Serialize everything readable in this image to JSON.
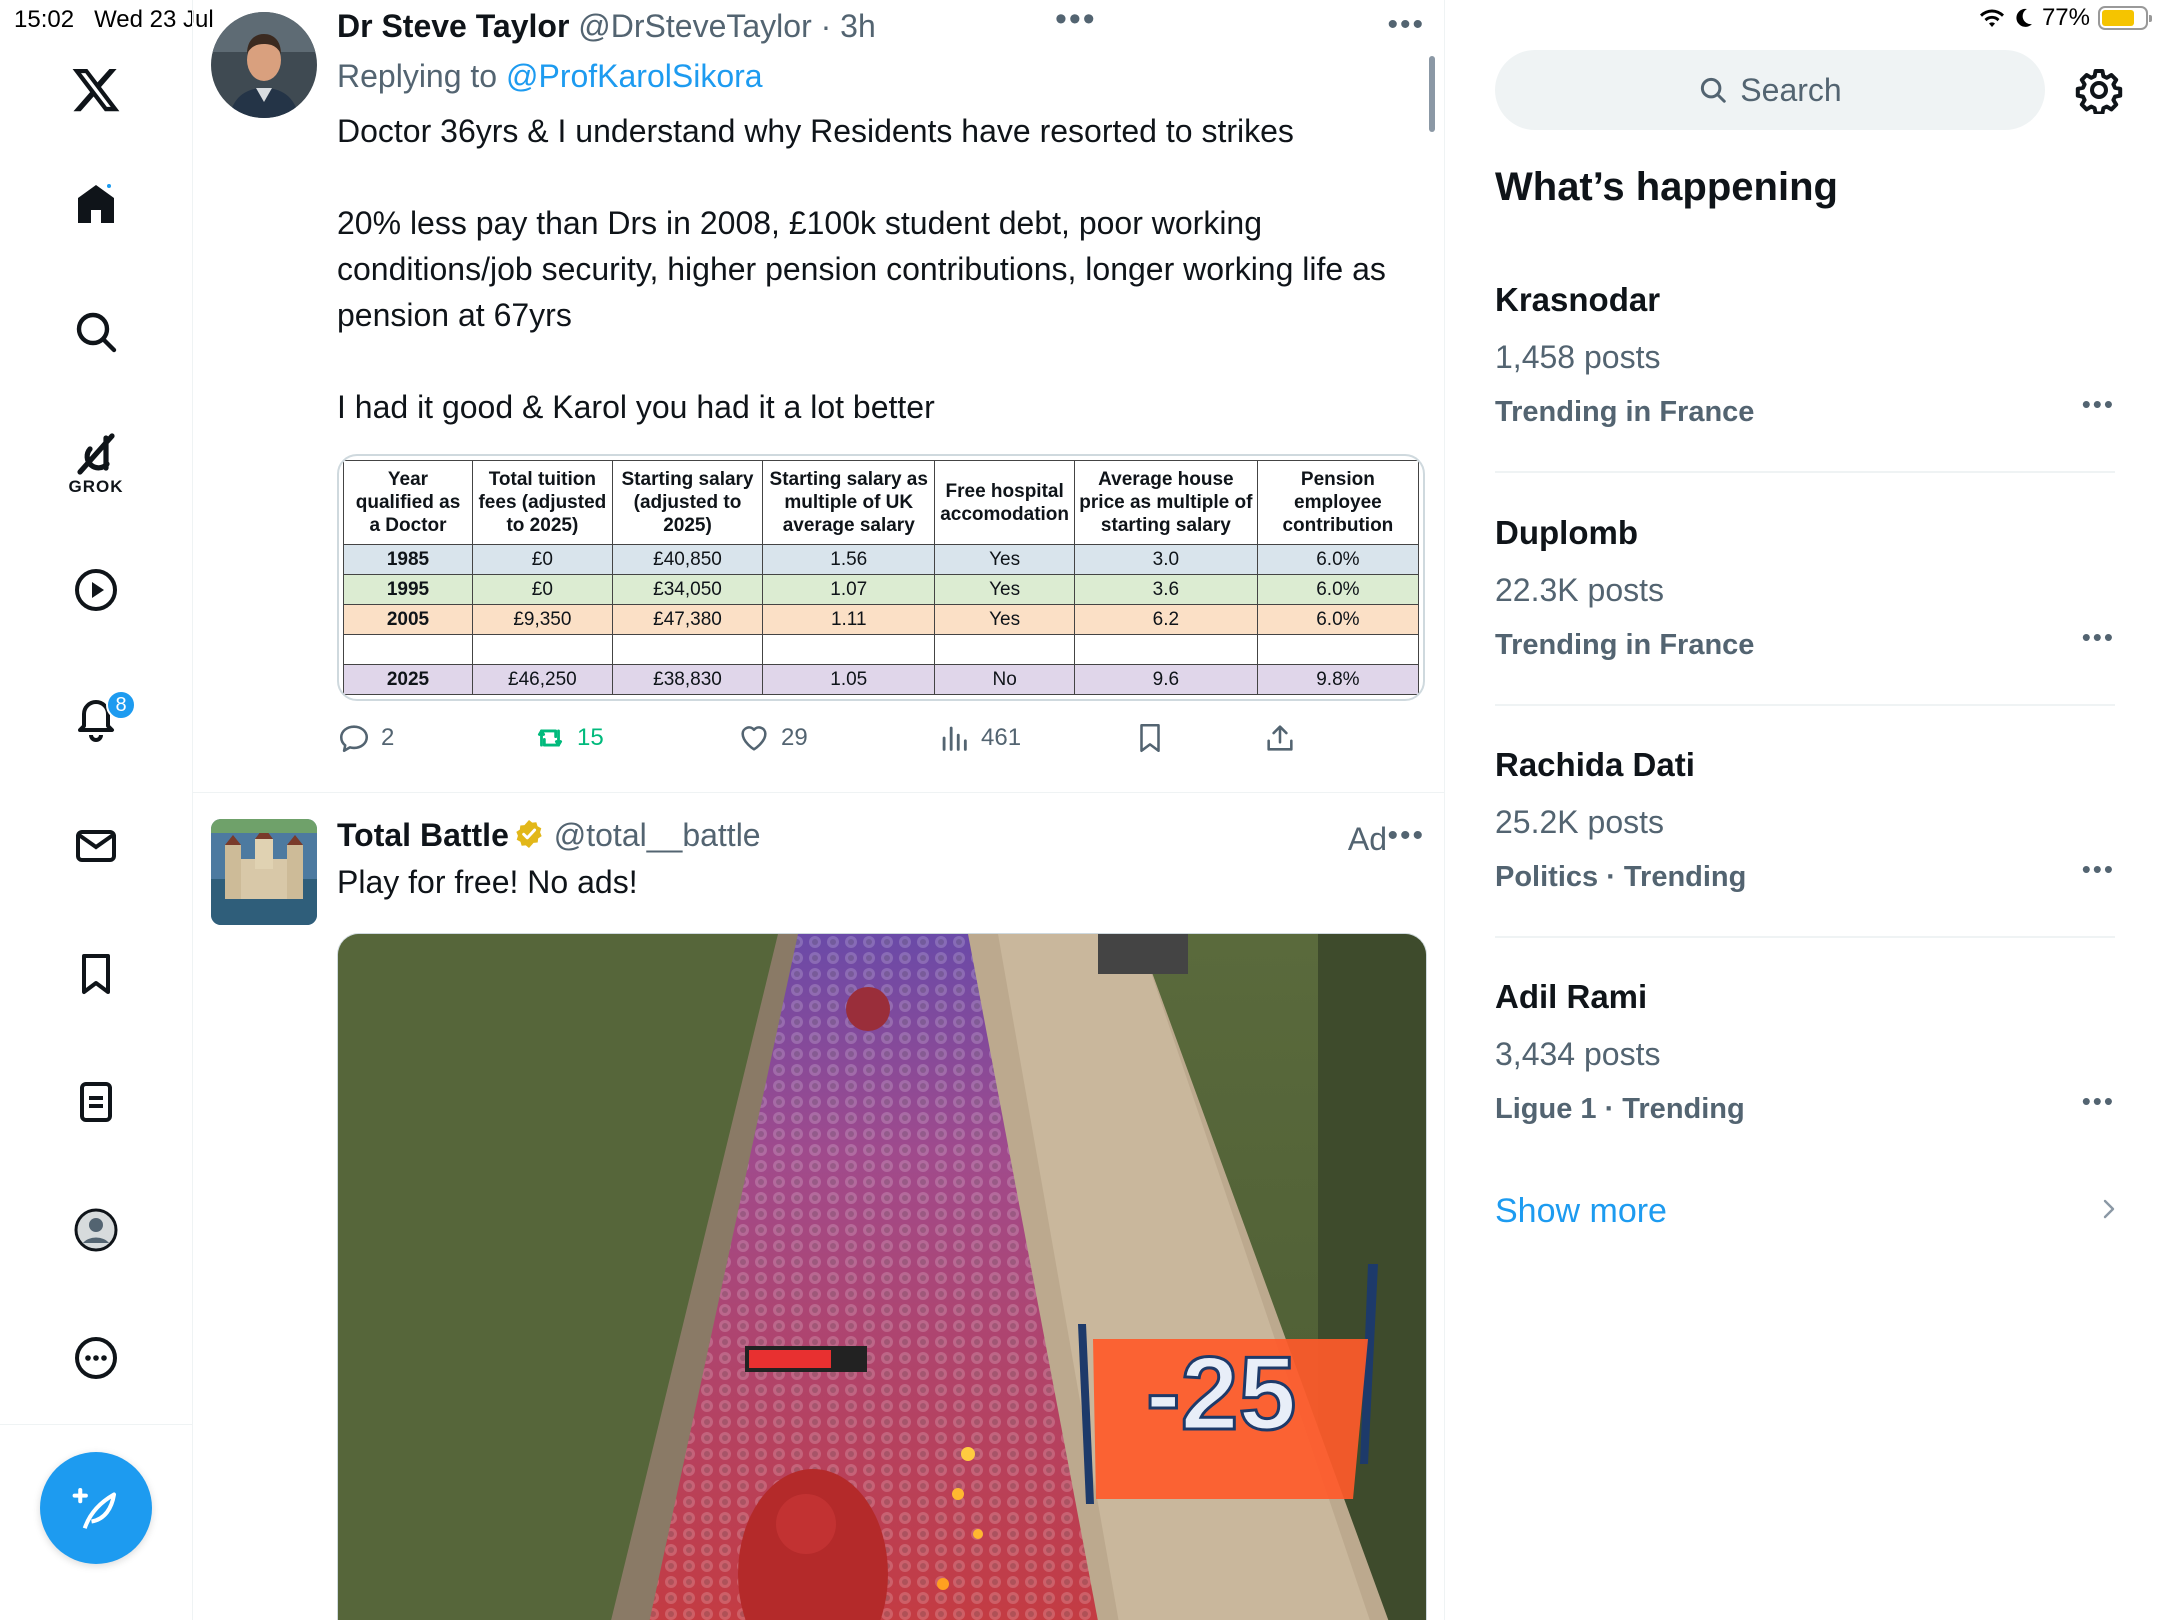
{
  "status": {
    "time": "15:02",
    "date": "Wed 23 Jul",
    "battery": "77%",
    "battery_level": 0.77
  },
  "nav": {
    "grok_label": "GROK",
    "notifications_badge": "8"
  },
  "tweet1": {
    "name": "Dr Steve Taylor",
    "handle": "@DrSteveTaylor",
    "time": "· 3h",
    "replying_to_prefix": "Replying to ",
    "replying_to_handle": "@ProfKarolSikora",
    "text_p1": "Doctor 36yrs & I understand why Residents have resorted to strikes",
    "text_p2": "20% less pay than Drs in 2008, £100k student debt, poor working conditions/job security, higher pension contributions, longer working life as pension at 67yrs",
    "text_p3": "I had it good & Karol you had it a lot better",
    "table": {
      "headers": [
        "Year qualified as a Doctor",
        "Total tuition fees (adjusted to 2025)",
        "Starting salary (adjusted to 2025)",
        "Starting salary as multiple of UK average salary",
        "Free hospital accomodation",
        "Average house price as multiple of starting salary",
        "Pension employee contribution"
      ],
      "rows": [
        [
          "1985",
          "£0",
          "£40,850",
          "1.56",
          "Yes",
          "3.0",
          "6.0%"
        ],
        [
          "1995",
          "£0",
          "£34,050",
          "1.07",
          "Yes",
          "3.6",
          "6.0%"
        ],
        [
          "2005",
          "£9,350",
          "£47,380",
          "1.11",
          "Yes",
          "6.2",
          "6.0%"
        ],
        [
          "",
          "",
          "",
          "",
          "",
          "",
          ""
        ],
        [
          "2025",
          "£46,250",
          "£38,830",
          "1.05",
          "No",
          "9.6",
          "9.8%"
        ]
      ]
    },
    "replies": "2",
    "reposts": "15",
    "likes": "29",
    "views": "461"
  },
  "tweet2": {
    "name": "Total Battle",
    "handle": "@total__battle",
    "ad_label": "Ad",
    "text": "Play for free! No ads!",
    "media_overlay": "-25"
  },
  "sidebar": {
    "search_placeholder": "Search",
    "title": "What’s happening",
    "trends": [
      {
        "name": "Krasnodar",
        "posts": "1,458 posts",
        "context": "Trending in France"
      },
      {
        "name": "Duplomb",
        "posts": "22.3K posts",
        "context": "Trending in France"
      },
      {
        "name": "Rachida Dati",
        "posts": "25.2K posts",
        "context": "Politics · Trending"
      },
      {
        "name": "Adil Rami",
        "posts": "3,434 posts",
        "context": "Ligue 1 · Trending"
      }
    ],
    "show_more": "Show more"
  },
  "colors": {
    "accent": "#1d9bf0",
    "repost_green": "#00ba7c",
    "muted": "#536471",
    "verified_gold": "#e2b719"
  }
}
